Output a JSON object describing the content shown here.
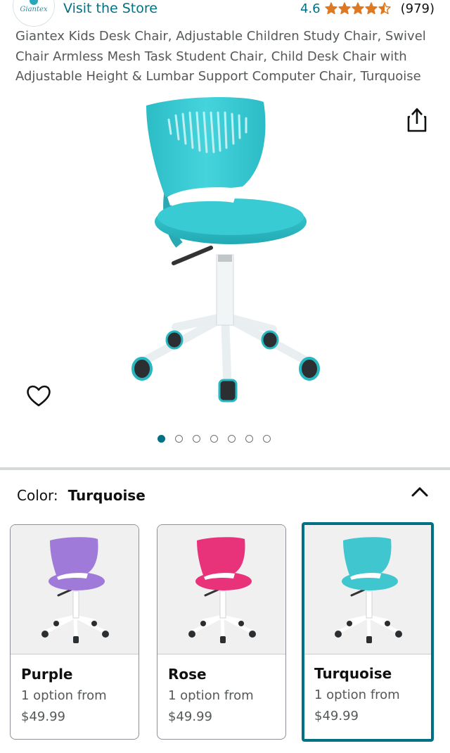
{
  "store": {
    "logo_text": "Giantex",
    "visit_label": "Visit the Store"
  },
  "rating": {
    "value": "4.6",
    "stars": 4.5,
    "count": "(979)",
    "star_color": "#de7921"
  },
  "product": {
    "title": "Giantex Kids Desk Chair, Adjustable Children Study Chair, Swivel Chair Armless Mesh Task Student Chair, Child Desk Chair with Adjustable Height & Lumbar Support Computer Chair, Turquoise",
    "image_icon": "turquoise-chair-image"
  },
  "gallery": {
    "total_images": 7,
    "active_index": 0
  },
  "color_selector": {
    "label": "Color:",
    "selected": "Turquoise",
    "collapse_icon": "chevron-up-icon",
    "options": [
      {
        "name": "Purple",
        "availability": "1 option from",
        "price": "$49.99",
        "color": "#a07ad8",
        "selected": false
      },
      {
        "name": "Rose",
        "availability": "1 option from",
        "price": "$49.99",
        "color": "#e8337a",
        "selected": false
      },
      {
        "name": "Turquoise",
        "availability": "1 option from",
        "price": "$49.99",
        "color": "#3fc6cf",
        "selected": true
      }
    ]
  },
  "colors": {
    "link": "#007185",
    "accent_selected": "#007185",
    "chair_main": "#33c3cc"
  }
}
